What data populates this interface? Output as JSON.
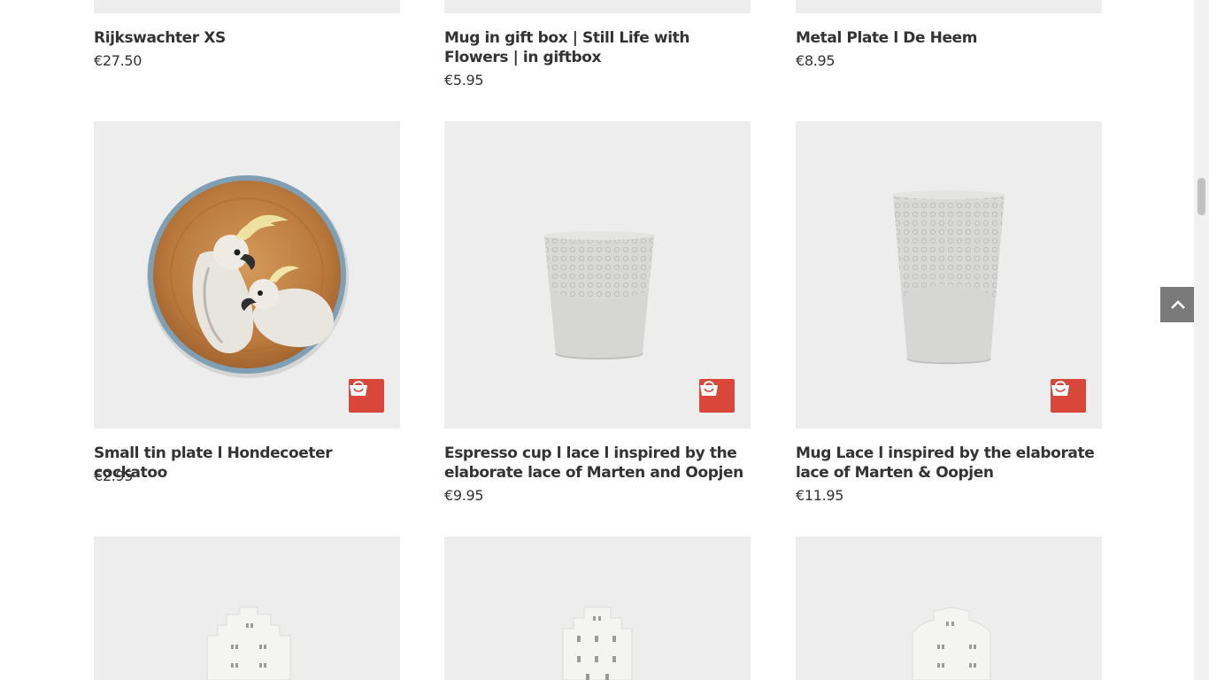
{
  "top_row": [
    {
      "title": "Rijkswachter XS",
      "price": "€27.50"
    },
    {
      "title": "Mug in gift box | Still Life with Flowers | in giftbox",
      "price": "€5.95"
    },
    {
      "title": "Metal Plate l De Heem",
      "price": "€8.95"
    }
  ],
  "middle_row": [
    {
      "title": "Small tin plate l Hondecoeter cockatoo",
      "price": "€2.95",
      "image": "cockatoo-plate"
    },
    {
      "title": "Espresso cup l lace l inspired by the elaborate lace of Marten and Oopjen",
      "price": "€9.95",
      "image": "lace-espresso-cup"
    },
    {
      "title": "Mug Lace l inspired by the elaborate lace of Marten & Oopjen",
      "price": "€11.95",
      "image": "lace-mug"
    }
  ],
  "bottom_row": [
    {
      "image": "porcelain-canal-house"
    },
    {
      "image": "porcelain-canal-house"
    },
    {
      "image": "porcelain-canal-house"
    }
  ],
  "icons": {
    "cart": "shopping-bag-icon",
    "back_to_top": "chevron-up-icon"
  },
  "colors": {
    "cart_button": "#d9463a",
    "thumb_bg": "#ededed",
    "back_to_top": "#7a7a7a"
  }
}
